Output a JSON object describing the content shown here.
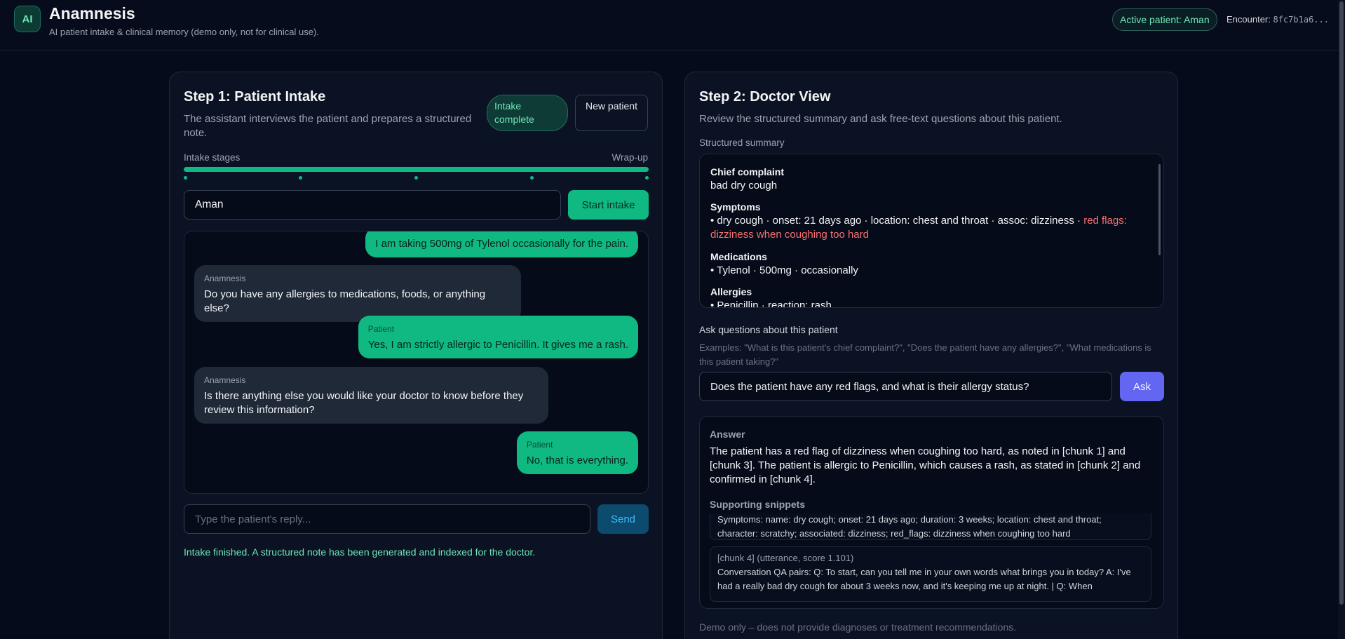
{
  "header": {
    "logo_text": "AI",
    "title": "Anamnesis",
    "subtitle": "AI patient intake & clinical memory (demo only, not for clinical use).",
    "active_patient": "Active patient: Aman",
    "encounter_label": "Encounter:",
    "encounter_id": "8fc7b1a6..."
  },
  "intake": {
    "title": "Step 1: Patient Intake",
    "description": "The assistant interviews the patient and prepares a structured note.",
    "status_pill": "Intake complete",
    "new_patient_label": "New patient",
    "stages_label": "Intake stages",
    "stages_end_label": "Wrap-up",
    "progress": 1.0,
    "stage_count": 5,
    "name_value": "Aman",
    "start_label": "Start intake",
    "messages": [
      {
        "role": "patient",
        "speaker": "",
        "text": "I am taking 500mg of Tylenol occasionally for the pain."
      },
      {
        "role": "assistant",
        "speaker": "Anamnesis",
        "text": "Do you have any allergies to medications, foods, or anything else?"
      },
      {
        "role": "patient",
        "speaker": "Patient",
        "text": "Yes, I am strictly allergic to Penicillin. It gives me a rash."
      },
      {
        "role": "assistant",
        "speaker": "Anamnesis",
        "text": "Is there anything else you would like your doctor to know before they review this information?"
      },
      {
        "role": "patient",
        "speaker": "Patient",
        "text": "No, that is everything."
      }
    ],
    "reply_placeholder": "Type the patient's reply...",
    "send_label": "Send",
    "status_message": "Intake finished. A structured note has been generated and indexed for the doctor."
  },
  "doctor": {
    "title": "Step 2: Doctor View",
    "description": "Review the structured summary and ask free-text questions about this patient.",
    "summary_label": "Structured summary",
    "summary": {
      "chief_complaint_title": "Chief complaint",
      "chief_complaint": "bad dry cough",
      "symptoms_title": "Symptoms",
      "symptoms_text": "• dry cough · onset: 21 days ago · location: chest and throat · assoc: dizziness ·",
      "symptoms_red_flags": "red flags:",
      "symptoms_red_flags_cont": "dizziness when coughing too hard",
      "medications_title": "Medications",
      "medications": "• Tylenol · 500mg · occasionally",
      "allergies_title": "Allergies",
      "allergies": "• Penicillin · reaction: rash"
    },
    "ask_label": "Ask questions about this patient",
    "examples": "Examples: \"What is this patient's chief complaint?\", \"Does the patient have any allergies?\", \"What medications is this patient taking?\"",
    "question_value": "Does the patient have any red flags, and what is their allergy status?",
    "ask_button": "Ask",
    "answer_label": "Answer",
    "answer_text": "The patient has a red flag of dizziness when coughing too hard, as noted in [chunk 1] and [chunk 3]. The patient is allergic to Penicillin, which causes a rash, as stated in [chunk 2] and confirmed in [chunk 4].",
    "snippets_label": "Supporting snippets",
    "snippets": [
      {
        "header": "",
        "text": "Symptoms: name: dry cough; onset: 21 days ago; duration: 3 weeks; location: chest and throat; character: scratchy; associated: dizziness; red_flags: dizziness when coughing too hard"
      },
      {
        "header": "[chunk 4] (utterance, score 1.101)",
        "text": "Conversation QA pairs: Q: To start, can you tell me in your own words what brings you in today? A: I've had a really bad dry cough for about 3 weeks now, and it's keeping me up at night. | Q: When"
      }
    ],
    "disclaimer": "Demo only – does not provide diagnoses or treatment recommendations."
  }
}
